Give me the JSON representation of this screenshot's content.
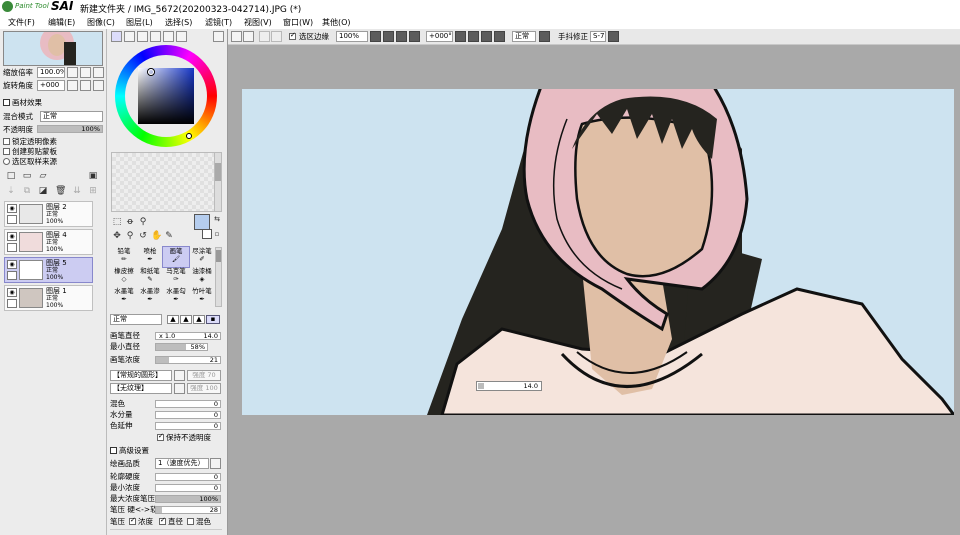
{
  "app": {
    "brand_small": "Paint Tool",
    "brand_big": "SAI",
    "title": "新建文件夹 / IMG_5672(20200323-042714).JPG (*)"
  },
  "menu": [
    "文件(F)",
    "编辑(E)",
    "图像(C)",
    "图层(L)",
    "选择(S)",
    "滤镜(T)",
    "视图(V)",
    "窗口(W)",
    "其他(O)"
  ],
  "navigator": {
    "zoom_label": "缩放倍率",
    "zoom_value": "100.0%",
    "rotate_label": "旋转角度",
    "rotate_value": "+000"
  },
  "layer_props": {
    "section_title": "画材效果",
    "blend_label": "混合模式",
    "blend_value": "正常",
    "opacity_label": "不透明度",
    "opacity_value": "100%",
    "checks": [
      "锁定透明像素",
      "创建剪贴蒙板",
      "选区取样来源"
    ]
  },
  "layers": [
    {
      "name": "图层 2",
      "mode": "正常",
      "opacity": "100%"
    },
    {
      "name": "图层 4",
      "mode": "正常",
      "opacity": "100%"
    },
    {
      "name": "图层 5",
      "mode": "正常",
      "opacity": "100%"
    },
    {
      "name": "图层 1",
      "mode": "正常",
      "opacity": "100%"
    }
  ],
  "toolbar": {
    "selection_edge": "选区边缘",
    "zoom": "100%",
    "angle": "+000°",
    "mode": "正常",
    "stabilizer_label": "手抖修正",
    "stabilizer_value": "S-7"
  },
  "tools": [
    {
      "name": "铅笔",
      "key": "N"
    },
    {
      "name": "喷枪",
      "key": ""
    },
    {
      "name": "画笔",
      "key": "B"
    },
    {
      "name": "尽涂笔",
      "key": ""
    },
    {
      "name": "橡皮擦",
      "key": "E"
    },
    {
      "name": "和纸笔",
      "key": ""
    },
    {
      "name": "马克笔",
      "key": "M"
    },
    {
      "name": "油漆桶",
      "key": ""
    },
    {
      "name": "水墨笔",
      "key": ""
    },
    {
      "name": "水墨渗",
      "key": ""
    },
    {
      "name": "水墨勾",
      "key": ""
    },
    {
      "name": "竹叶笔",
      "key": ""
    }
  ],
  "brush": {
    "mode": "正常",
    "size_label": "画笔直径",
    "size_mult": "x 1.0",
    "size_value": "14.0",
    "min_size_label": "最小直径",
    "min_size_value": "58%",
    "density_label": "画笔浓度",
    "density_value": "21",
    "shape_label": "【常规的圆形】",
    "shape_strength": "强度",
    "shape_val": "70",
    "texture_label": "【无纹理】",
    "texture_strength": "强度",
    "texture_val": "100",
    "blend_label": "混色",
    "blend_value": "0",
    "water_label": "水分量",
    "water_value": "0",
    "persist_label": "色延伸",
    "persist_value": "0",
    "keep_opacity": "保持不透明度",
    "advanced_title": "高级设置",
    "quality_label": "绘画品质",
    "quality_value": "1（速度优先）",
    "edge_label": "轮廓硬度",
    "edge_value": "0",
    "min_density_label": "最小浓度",
    "min_density_value": "0",
    "max_pressure_label": "最大浓度笔压",
    "max_pressure_value": "100%",
    "pressure_label": "笔压 硬<->软",
    "pressure_value": "28",
    "pressure_row": "笔压",
    "pressure_density": "浓度",
    "pressure_size": "直径",
    "pressure_blend": "混色"
  },
  "overlay": {
    "size_value": "14.0"
  },
  "colors": {
    "canvas_bg": "#cde3f0",
    "hood": "#e8bcc3",
    "skin": "#e0bfa6",
    "hair": "#25241f",
    "shirt": "#f5e4dc",
    "workspace": "#a9a9a9"
  }
}
